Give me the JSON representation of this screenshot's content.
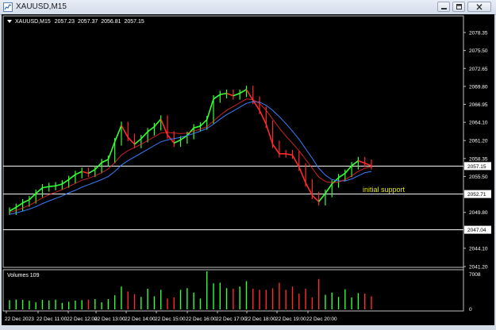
{
  "window": {
    "title": "XAUUSD,M15",
    "app_icon": "chart-icon",
    "buttons": [
      "minimize-icon",
      "maximize-icon",
      "close-icon"
    ]
  },
  "header": {
    "symbol": "XAUUSD,M15",
    "open": "2057.23",
    "high": "2057.37",
    "low": "2056.81",
    "close": "2057.15"
  },
  "colors": {
    "bull": "#33ff33",
    "bear": "#ff2a2a",
    "background": "#000000",
    "text": "#ffffff",
    "fast_ma": "#ff2a2a",
    "slow_ma": "#3a7dff",
    "annotation": "#e6e600",
    "axis": "#c0c0c0",
    "level_line": "#ffffff"
  },
  "levels": [
    {
      "price": 2057.15,
      "label": "2057.15"
    },
    {
      "price": 2052.71,
      "label": "2052.71"
    },
    {
      "price": 2047.04,
      "label": "2047.04"
    }
  ],
  "annotation": {
    "text": "initial support"
  },
  "volume_panel": {
    "label": "Volumes 109",
    "max_label": "7008",
    "zero_label": "0"
  },
  "chart_data": {
    "type": "line",
    "price_axis": {
      "ticks": [
        "2078.35",
        "2075.50",
        "2072.65",
        "2069.80",
        "2066.95",
        "2064.10",
        "2061.20",
        "2058.35",
        "2055.50",
        "2049.80",
        "2044.10",
        "2041.20"
      ]
    },
    "time_axis": {
      "labels": [
        "22 Dec 2023",
        "22 Dec 11:00",
        "22 Dec 12:00",
        "22 Dec 13:00",
        "22 Dec 14:00",
        "22 Dec 15:00",
        "22 Dec 16:00",
        "22 Dec 17:00",
        "22 Dec 18:00",
        "22 Dec 19:00",
        "22 Dec 20:00"
      ]
    },
    "price_series": [
      2050.0,
      2050.6,
      2051.3,
      2051.8,
      2052.8,
      2053.7,
      2053.9,
      2054.0,
      2054.3,
      2055.0,
      2055.8,
      2056.3,
      2056.0,
      2056.6,
      2057.7,
      2058.2,
      2061.0,
      2063.6,
      2061.7,
      2060.6,
      2061.5,
      2062.6,
      2063.4,
      2064.6,
      2062.1,
      2060.8,
      2061.3,
      2062.0,
      2063.2,
      2063.5,
      2064.5,
      2067.8,
      2068.5,
      2068.7,
      2068.3,
      2068.7,
      2069.3,
      2067.6,
      2066.0,
      2063.8,
      2060.6,
      2059.1,
      2059.1,
      2058.9,
      2057.0,
      2054.5,
      2052.5,
      2051.5,
      2052.8,
      2054.3,
      2055.3,
      2056.0,
      2057.2,
      2058.0,
      2057.6,
      2057.2
    ],
    "direction": [
      "bull",
      "bull",
      "bull",
      "bull",
      "bull",
      "bull",
      "bull",
      "bull",
      "bull",
      "bull",
      "bull",
      "bull",
      "bear",
      "bull",
      "bull",
      "bull",
      "bull",
      "bull",
      "bear",
      "bear",
      "bull",
      "bull",
      "bull",
      "bull",
      "bear",
      "bear",
      "bull",
      "bull",
      "bull",
      "bull",
      "bull",
      "bull",
      "bull",
      "bull",
      "bear",
      "bull",
      "bull",
      "bear",
      "bear",
      "bear",
      "bear",
      "bear",
      "bear",
      "bear",
      "bear",
      "bear",
      "bear",
      "bear",
      "bull",
      "bull",
      "bull",
      "bull",
      "bull",
      "bull",
      "bear",
      "bear"
    ],
    "volumes": [
      1700,
      1800,
      1750,
      1600,
      1300,
      1750,
      1650,
      1800,
      1200,
      1400,
      1600,
      1700,
      1800,
      1900,
      1300,
      1900,
      2600,
      4200,
      3300,
      2800,
      2300,
      3800,
      2400,
      3600,
      2000,
      2200,
      3600,
      3900,
      3100,
      2000,
      7008,
      4800,
      4900,
      3900,
      3800,
      4200,
      5200,
      3800,
      3600,
      3600,
      3900,
      4900,
      3600,
      4200,
      2900,
      3800,
      2200,
      5600,
      2700,
      3100,
      2300,
      3700,
      2200,
      3000,
      2900,
      2400
    ],
    "fast_ma": [
      2049.8,
      2050.1,
      2050.5,
      2050.9,
      2051.5,
      2052.1,
      2052.6,
      2053.0,
      2053.4,
      2053.9,
      2054.4,
      2054.9,
      2055.2,
      2055.6,
      2056.1,
      2056.7,
      2057.7,
      2058.9,
      2059.6,
      2060.1,
      2060.6,
      2061.2,
      2061.8,
      2062.4,
      2062.5,
      2062.4,
      2062.3,
      2062.4,
      2062.7,
      2063.0,
      2063.4,
      2064.3,
      2065.2,
      2066.0,
      2066.6,
      2067.2,
      2067.8,
      2067.7,
      2067.1,
      2066.0,
      2064.6,
      2063.2,
      2061.9,
      2060.8,
      2059.6,
      2058.2,
      2056.8,
      2055.4,
      2054.7,
      2054.5,
      2054.6,
      2055.0,
      2055.6,
      2056.3,
      2056.8,
      2057.0
    ],
    "slow_ma": [
      2049.5,
      2049.7,
      2050.0,
      2050.3,
      2050.7,
      2051.2,
      2051.6,
      2052.0,
      2052.4,
      2052.9,
      2053.3,
      2053.8,
      2054.2,
      2054.6,
      2055.0,
      2055.5,
      2056.3,
      2057.3,
      2058.0,
      2058.6,
      2059.2,
      2059.8,
      2060.4,
      2061.0,
      2061.3,
      2061.5,
      2061.7,
      2062.0,
      2062.3,
      2062.7,
      2063.1,
      2063.8,
      2064.6,
      2065.3,
      2065.9,
      2066.5,
      2067.1,
      2067.4,
      2067.3,
      2066.8,
      2066.0,
      2065.0,
      2063.9,
      2062.7,
      2061.4,
      2059.9,
      2058.4,
      2056.8,
      2055.7,
      2055.0,
      2054.8,
      2054.8,
      2055.1,
      2055.6,
      2056.1,
      2056.3
    ]
  }
}
